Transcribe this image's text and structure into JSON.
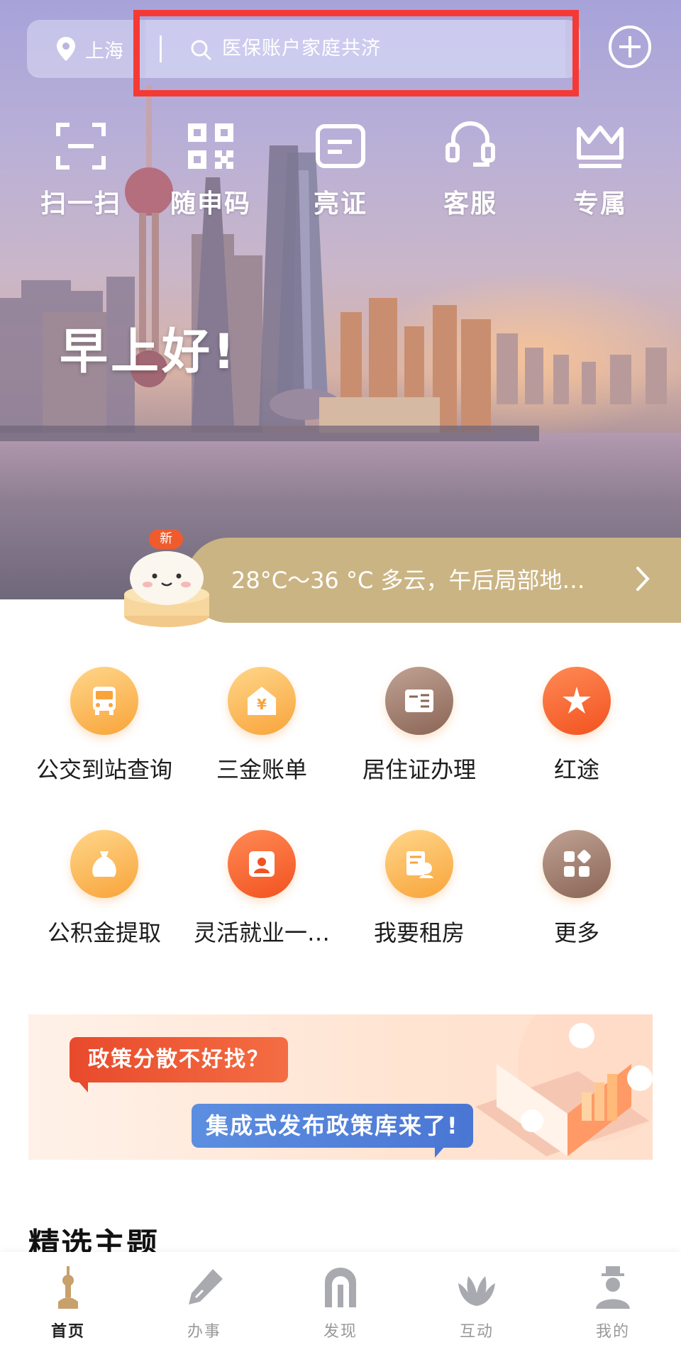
{
  "location": {
    "city": "上海"
  },
  "search": {
    "placeholder": "医保账户家庭共济"
  },
  "quick_actions": [
    {
      "label": "扫一扫",
      "icon": "scan-icon"
    },
    {
      "label": "随申码",
      "icon": "qr-code-icon"
    },
    {
      "label": "亮证",
      "icon": "id-card-icon"
    },
    {
      "label": "客服",
      "icon": "headset-icon"
    },
    {
      "label": "专属",
      "icon": "crown-icon"
    }
  ],
  "greeting": "早上好!",
  "weather": {
    "badge": "新",
    "text": "28°C～36 °C 多云，午后局部地…"
  },
  "services": [
    {
      "label": "公交到站查询",
      "icon": "bus-icon",
      "color": "#f8a43a"
    },
    {
      "label": "三金账单",
      "icon": "yen-house-icon",
      "color": "#f8a43a"
    },
    {
      "label": "居住证办理",
      "icon": "residence-card-icon",
      "color": "#8a6555"
    },
    {
      "label": "红途",
      "icon": "red-star-icon",
      "color": "#f25220"
    },
    {
      "label": "公积金提取",
      "icon": "money-bag-icon",
      "color": "#f8a43a"
    },
    {
      "label": "灵活就业一…",
      "icon": "flexible-job-icon",
      "color": "#f25220"
    },
    {
      "label": "我要租房",
      "icon": "rent-house-icon",
      "color": "#f8a43a"
    },
    {
      "label": "更多",
      "icon": "more-apps-icon",
      "color": "#8a6555"
    }
  ],
  "banner": {
    "line1": "政策分散不好找？",
    "line2": "集成式发布政策库来了!"
  },
  "section": {
    "title": "精选主题"
  },
  "tabs": [
    {
      "label": "首页",
      "icon": "tower-icon",
      "active": true
    },
    {
      "label": "办事",
      "icon": "pen-icon",
      "active": false
    },
    {
      "label": "发现",
      "icon": "arch-icon",
      "active": false
    },
    {
      "label": "互动",
      "icon": "magnolia-icon",
      "active": false
    },
    {
      "label": "我的",
      "icon": "person-icon",
      "active": false
    }
  ]
}
